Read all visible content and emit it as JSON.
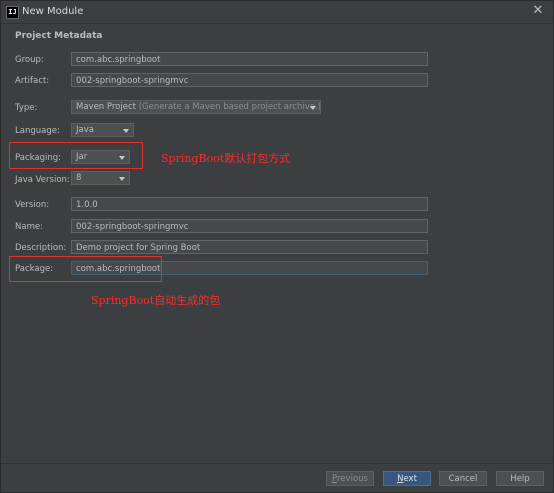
{
  "window": {
    "title": "New Module",
    "app_icon": "IJ",
    "close": "✕"
  },
  "section_title": "Project Metadata",
  "form": {
    "group": {
      "label": "Group:",
      "value": "com.abc.springboot"
    },
    "artifact": {
      "label": "Artifact:",
      "value": "002-springboot-springmvc"
    },
    "type": {
      "label": "Type:",
      "value": "Maven Project",
      "hint": "(Generate a Maven based project archive.)"
    },
    "language": {
      "label": "Language:",
      "value": "Java"
    },
    "packaging": {
      "label": "Packaging:",
      "value": "Jar"
    },
    "java_version": {
      "label": "Java Version:",
      "value": "8"
    },
    "version": {
      "label": "Version:",
      "value": "1.0.0"
    },
    "name": {
      "label": "Name:",
      "value": "002-springboot-springmvc"
    },
    "description": {
      "label": "Description:",
      "value": "Demo project for Spring Boot"
    },
    "package": {
      "label": "Package:",
      "value": "com.abc.springboot"
    }
  },
  "annotations": {
    "packaging_note": "SpringBoot默认打包方式",
    "package_note": "SpringBoot自动生成的包"
  },
  "buttons": {
    "previous_mnemonic": "P",
    "previous_rest": "revious",
    "next_mnemonic": "N",
    "next_rest": "ext",
    "cancel": "Cancel",
    "help": "Help"
  },
  "colors": {
    "accent": "#365880",
    "annotation": "#ff2b2b",
    "background": "#3c3f41"
  }
}
